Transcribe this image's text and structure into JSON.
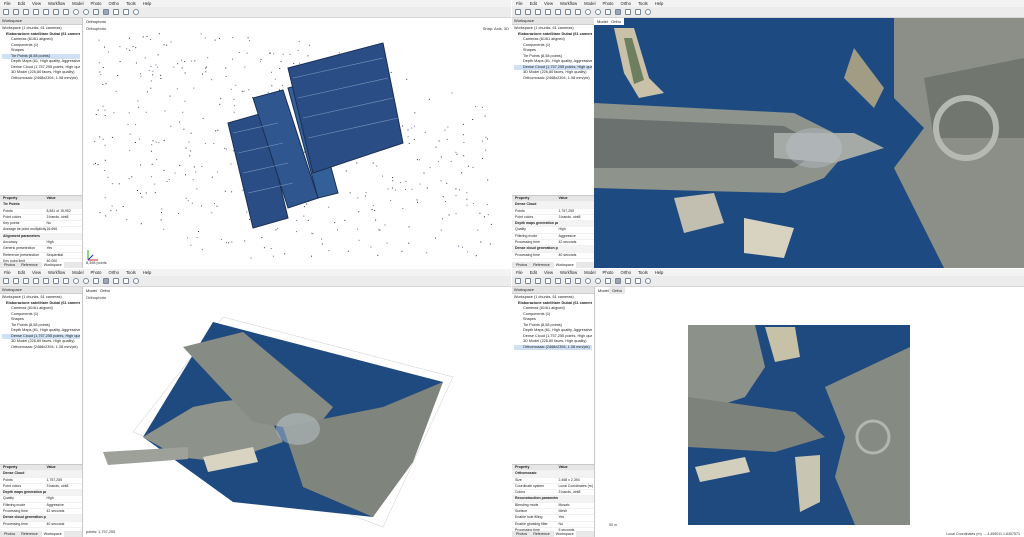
{
  "menus": [
    "File",
    "Edit",
    "View",
    "Workflow",
    "Model",
    "Photo",
    "Ortho",
    "Tools",
    "Help"
  ],
  "menus_alt": [
    "File",
    "Edit",
    "View",
    "Workflow",
    "Model",
    "Photo",
    "Ortho",
    "Tools",
    "Help"
  ],
  "workspace": {
    "title": "Workspace",
    "root": "Workspace (1 chunks, 61 cameras)",
    "chunk": "Elaborazione satellitare Dubai (61 cameras, 8,591,250 points)",
    "items": [
      "Cameras (61/61 aligned)",
      "Components (1)",
      "Shapes",
      "Tie Points (8,58 points)",
      "Depth Maps (61, High quality, Aggressive filtering)",
      "Dense Cloud (1,757,255 points, High quality)",
      "3D Model (226,80 faces, High quality)",
      "Orthomosaic (2468x2394, 1.08 mm/pix)"
    ]
  },
  "panels": {
    "tl": {
      "view_tab": "Orthophoto",
      "view_label": "Orthophoto",
      "right_label": "Snap: Axis, 3D",
      "footer": "8,398 points",
      "props": [
        [
          "Property",
          "Value",
          "h"
        ],
        [
          "Tie Points",
          "",
          "g"
        ],
        [
          "Points",
          "8,581 of 15,952",
          ""
        ],
        [
          "Point colors",
          "3 bands, uint8",
          ""
        ],
        [
          "Key points",
          "No",
          ""
        ],
        [
          "Average tie point multiplicity",
          "16.696",
          ""
        ],
        [
          "Alignment parameters",
          "",
          "g"
        ],
        [
          "Accuracy",
          "High",
          ""
        ],
        [
          "Generic preselection",
          "Yes",
          ""
        ],
        [
          "Reference preselection",
          "Sequential",
          ""
        ],
        [
          "Key point limit",
          "40,000",
          ""
        ]
      ],
      "tabs": [
        "Photos",
        "Reference",
        "Workspace"
      ]
    },
    "tr": {
      "view_tab": "Model",
      "view_tab2": "Ortho",
      "props": [
        [
          "Property",
          "Value",
          "h"
        ],
        [
          "Dense Cloud",
          "",
          "g"
        ],
        [
          "Points",
          "1,757,255",
          ""
        ],
        [
          "Point colors",
          "3 bands, uint8",
          ""
        ],
        [
          "Depth maps generation parameters",
          "",
          "g"
        ],
        [
          "Quality",
          "High",
          ""
        ],
        [
          "Filtering mode",
          "Aggressive",
          ""
        ],
        [
          "Processing time",
          "42 seconds",
          ""
        ],
        [
          "Dense cloud generation parameters",
          "",
          "g"
        ],
        [
          "Processing time",
          "40 seconds",
          ""
        ]
      ],
      "tabs": [
        "Photos",
        "Reference",
        "Workspace"
      ]
    },
    "bl": {
      "view_tab": "Model",
      "view_tab2": "Ortho",
      "view_label": "Orthophoto",
      "footer": "points: 1,757,255",
      "props": [
        [
          "Property",
          "Value",
          "h"
        ],
        [
          "Dense Cloud",
          "",
          "g"
        ],
        [
          "Points",
          "1,757,255",
          ""
        ],
        [
          "Point colors",
          "3 bands, uint8",
          ""
        ],
        [
          "Depth maps generation parameters",
          "",
          "g"
        ],
        [
          "Quality",
          "High",
          ""
        ],
        [
          "Filtering mode",
          "Aggressive",
          ""
        ],
        [
          "Processing time",
          "42 seconds",
          ""
        ],
        [
          "Dense cloud generation parameters",
          "",
          "g"
        ],
        [
          "Processing time",
          "40 seconds",
          ""
        ]
      ],
      "tabs": [
        "Photos",
        "Reference",
        "Workspace"
      ]
    },
    "br": {
      "view_tab": "Model",
      "view_tab2": "Ortho",
      "scale": "50 m",
      "status": "Local Coordinates (m) ↔ 4.459011 1.6357571",
      "props": [
        [
          "Property",
          "Value",
          "h"
        ],
        [
          "Orthomosaic",
          "",
          "g"
        ],
        [
          "Size",
          "2,468 x 2,394",
          ""
        ],
        [
          "Coordinate system",
          "Local Coordinates (m)",
          ""
        ],
        [
          "Colors",
          "3 bands, uint8",
          ""
        ],
        [
          "Reconstruction parameters",
          "",
          "g"
        ],
        [
          "Blending mode",
          "Mosaic",
          ""
        ],
        [
          "Surface",
          "Mesh",
          ""
        ],
        [
          "Enable hole filling",
          "Yes",
          ""
        ],
        [
          "Enable ghosting filter",
          "No",
          ""
        ],
        [
          "Processing time",
          "5 seconds",
          ""
        ]
      ],
      "tabs": [
        "Photos",
        "Reference",
        "Workspace"
      ]
    }
  },
  "colors": {
    "water": "#1f4a80",
    "land": "#8a8f86",
    "selection": "#cfe0f5"
  }
}
